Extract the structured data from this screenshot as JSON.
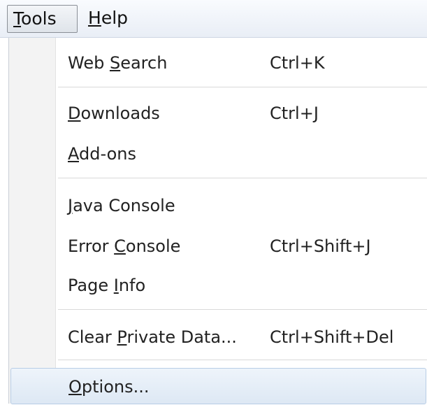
{
  "menubar": {
    "tools": {
      "pre": "",
      "accel": "T",
      "post": "ools"
    },
    "help": {
      "pre": "",
      "accel": "H",
      "post": "elp"
    }
  },
  "menu": {
    "items": [
      {
        "pre": "Web ",
        "accel": "S",
        "post": "earch",
        "shortcut": "Ctrl+K"
      },
      {
        "pre": "",
        "accel": "D",
        "post": "ownloads",
        "shortcut": "Ctrl+J"
      },
      {
        "pre": "",
        "accel": "A",
        "post": "dd-ons",
        "shortcut": ""
      },
      {
        "pre": "",
        "accel": "J",
        "post": "ava Console",
        "shortcut": ""
      },
      {
        "pre": "Error ",
        "accel": "C",
        "post": "onsole",
        "shortcut": "Ctrl+Shift+J"
      },
      {
        "pre": "Page ",
        "accel": "I",
        "post": "nfo",
        "shortcut": ""
      },
      {
        "pre": "Clear ",
        "accel": "P",
        "post": "rivate Data...",
        "shortcut": "Ctrl+Shift+Del"
      },
      {
        "pre": "",
        "accel": "O",
        "post": "ptions...",
        "shortcut": ""
      }
    ]
  }
}
